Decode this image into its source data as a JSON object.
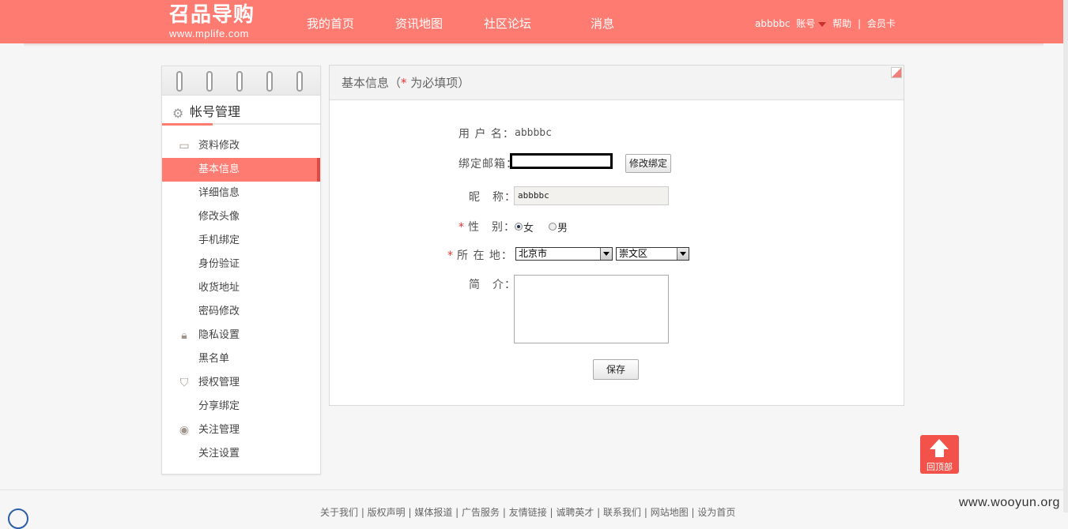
{
  "header": {
    "logo_text": "召品导购",
    "logo_url": "www.mplife.com",
    "nav": [
      "我的首页",
      "资讯地图",
      "社区论坛",
      "消息"
    ],
    "username": "abbbbc",
    "account_label": "账号",
    "help_label": "帮助",
    "separator": "|",
    "member_card_label": "会员卡"
  },
  "sidebar": {
    "title": "帐号管理",
    "items": [
      {
        "label": "资料修改",
        "type": "group",
        "icon": "id-card-icon"
      },
      {
        "label": "基本信息",
        "type": "sub",
        "active": true
      },
      {
        "label": "详细信息",
        "type": "sub"
      },
      {
        "label": "修改头像",
        "type": "sub"
      },
      {
        "label": "手机绑定",
        "type": "sub"
      },
      {
        "label": "身份验证",
        "type": "sub"
      },
      {
        "label": "收货地址",
        "type": "sub"
      },
      {
        "label": "密码修改",
        "type": "sub"
      },
      {
        "label": "隐私设置",
        "type": "group",
        "icon": "lock-icon"
      },
      {
        "label": "黑名单",
        "type": "sub"
      },
      {
        "label": "授权管理",
        "type": "group",
        "icon": "shield-icon"
      },
      {
        "label": "分享绑定",
        "type": "sub"
      },
      {
        "label": "关注管理",
        "type": "group",
        "icon": "eye-icon"
      },
      {
        "label": "关注设置",
        "type": "sub"
      }
    ]
  },
  "form": {
    "title_prefix": "基本信息（",
    "title_star": "*",
    "title_suffix": " 为必填项）",
    "username_label": "用 户 名：",
    "username_value": "abbbbc",
    "email_label": "绑定邮箱：",
    "email_button": "修改绑定",
    "nickname_label": "昵　称：",
    "nickname_value": "abbbbc",
    "gender_star": "*",
    "gender_label": "性　别：",
    "gender_female": "女",
    "gender_male": "男",
    "gender_selected": "女",
    "location_star": "*",
    "location_label": "所 在 地：",
    "city": "北京市",
    "district": "崇文区",
    "intro_label": "简　介：",
    "save_button": "保存"
  },
  "back_to_top": "回顶部",
  "footer": {
    "links": "关于我们 | 版权声明 | 媒体报道 | 广告服务 | 友情链接 | 诚聘英才 | 联系我们 | 网站地图 | 设为首页"
  },
  "watermark": "www.wooyun.org",
  "colors": {
    "accent": "#fe7b72",
    "required": "#ee3333",
    "back_to_top": "#f2524a"
  }
}
